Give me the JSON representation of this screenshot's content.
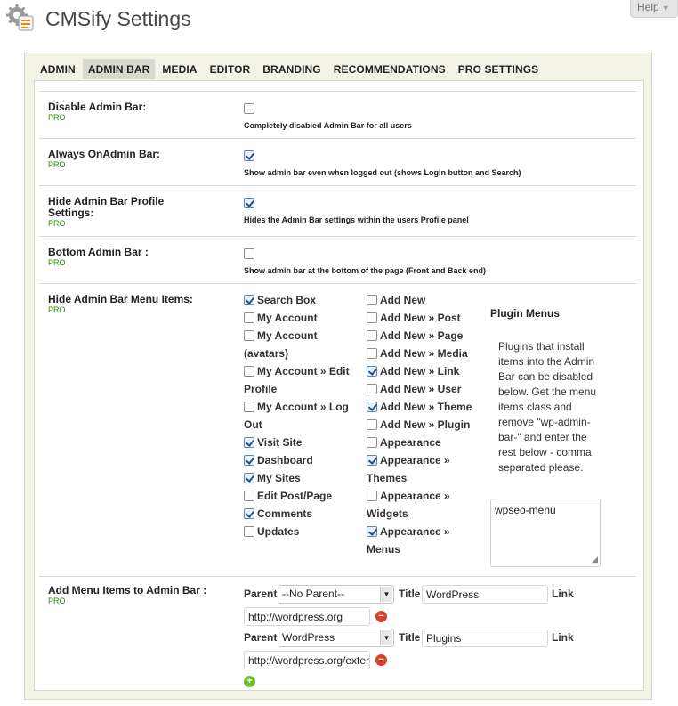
{
  "help": {
    "label": "Help"
  },
  "page": {
    "title": "CMSify Settings"
  },
  "tabs": [
    "ADMIN",
    "ADMIN BAR",
    "MEDIA",
    "EDITOR",
    "BRANDING",
    "RECOMMENDATIONS",
    "PRO SETTINGS"
  ],
  "active_tab": "ADMIN BAR",
  "pro_label": "PRO",
  "settings": {
    "disable": {
      "label": "Disable Admin Bar:",
      "checked": false,
      "desc": "Completely disabled Admin Bar for all users"
    },
    "always_on": {
      "label": "Always OnAdmin Bar:",
      "checked": true,
      "desc": "Show admin bar even when logged out (shows Login button and Search)"
    },
    "hide_profile": {
      "label": "Hide Admin Bar Profile Settings:",
      "checked": true,
      "desc": "Hides the Admin Bar settings within the users Profile panel"
    },
    "bottom": {
      "label": "Bottom Admin Bar :",
      "checked": false,
      "desc": "Show admin bar at the bottom of the page (Front and Back end)"
    }
  },
  "hide_menu": {
    "label": "Hide Admin Bar Menu Items:",
    "col1": [
      {
        "label": "Search Box",
        "checked": true
      },
      {
        "label": "My Account",
        "checked": false
      },
      {
        "label": "My Account (avatars)",
        "checked": false
      },
      {
        "label": "My Account » Edit Profile",
        "checked": false
      },
      {
        "label": "My Account » Log Out",
        "checked": false
      },
      {
        "label": "Visit Site",
        "checked": true
      },
      {
        "label": "Dashboard",
        "checked": true
      },
      {
        "label": "My Sites",
        "checked": true
      },
      {
        "label": "Edit Post/Page",
        "checked": false
      },
      {
        "label": "Comments",
        "checked": true
      },
      {
        "label": "Updates",
        "checked": false
      }
    ],
    "col2": [
      {
        "label": "Add New",
        "checked": false
      },
      {
        "label": "Add New » Post",
        "checked": false
      },
      {
        "label": "Add New » Page",
        "checked": false
      },
      {
        "label": "Add New » Media",
        "checked": false
      },
      {
        "label": "Add New » Link",
        "checked": true
      },
      {
        "label": "Add New » User",
        "checked": false
      },
      {
        "label": "Add New » Theme",
        "checked": true
      },
      {
        "label": "Add New » Plugin",
        "checked": false
      },
      {
        "label": "Appearance",
        "checked": false
      },
      {
        "label": "Appearance » Themes",
        "checked": true
      },
      {
        "label": "Appearance » Widgets",
        "checked": false
      },
      {
        "label": "Appearance » Menus",
        "checked": true
      }
    ],
    "plugin_menus": {
      "title": "Plugin Menus",
      "text": "Plugins that install items into the Admin Bar can be disabled below. Get the menu items class and remove \"wp-admin-bar-\" and enter the rest below - comma separated please.",
      "value": "wpseo-menu"
    }
  },
  "add_menu": {
    "label": "Add Menu Items to Admin Bar :",
    "parent_label": "Parent",
    "title_label": "Title",
    "link_label": "Link",
    "items": [
      {
        "parent": "--No Parent--",
        "title": "WordPress",
        "link": "http://wordpress.org"
      },
      {
        "parent": "WordPress",
        "title": "Plugins",
        "link": "http://wordpress.org/extend/plugins"
      }
    ]
  }
}
